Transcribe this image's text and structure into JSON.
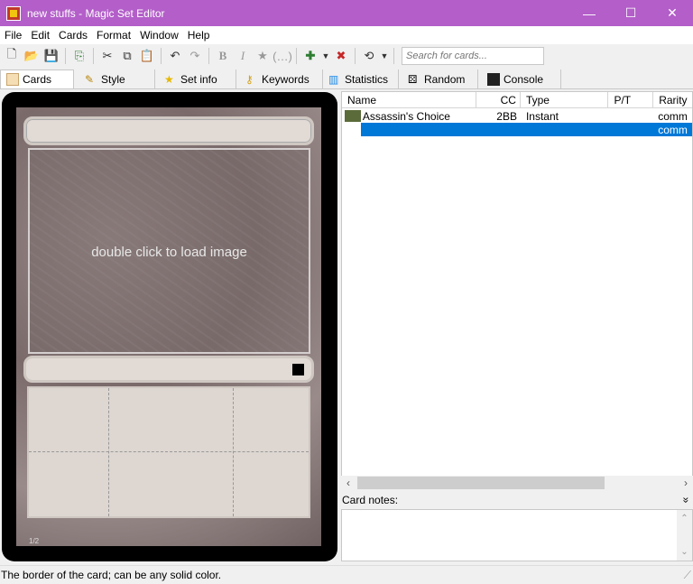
{
  "window": {
    "title": "new stuffs - Magic Set Editor",
    "titlebar_color": "#b35ec9",
    "controls": {
      "minimize": "—",
      "maximize": "☐",
      "close": "✕"
    }
  },
  "menu": [
    "File",
    "Edit",
    "Cards",
    "Format",
    "Window",
    "Help"
  ],
  "toolbar": {
    "search_placeholder": "Search for cards..."
  },
  "tabs": [
    {
      "label": "Cards",
      "icon": "cards-icon",
      "active": true
    },
    {
      "label": "Style",
      "icon": "brush-icon"
    },
    {
      "label": "Set info",
      "icon": "star-icon"
    },
    {
      "label": "Keywords",
      "icon": "key-icon"
    },
    {
      "label": "Statistics",
      "icon": "bar-chart-icon"
    },
    {
      "label": "Random",
      "icon": "dice-icon"
    },
    {
      "label": "Console",
      "icon": "console-icon"
    }
  ],
  "card": {
    "art_hint": "double click to load image",
    "footer": "1/2"
  },
  "card_list": {
    "columns": [
      "Name",
      "CC",
      "Type",
      "P/T",
      "Rarity"
    ],
    "rows": [
      {
        "name": "Assassin's Choice",
        "cc": "2BB",
        "type": "Instant",
        "pt": "",
        "rarity": "comm",
        "selected": false
      },
      {
        "name": "",
        "cc": "",
        "type": "",
        "pt": "",
        "rarity": "comm",
        "selected": true
      }
    ]
  },
  "notes": {
    "label": "Card notes:",
    "toggle": "»"
  },
  "status": {
    "text": "The border of the card; can be any solid color."
  },
  "colors": {
    "selection": "#0078d7"
  }
}
